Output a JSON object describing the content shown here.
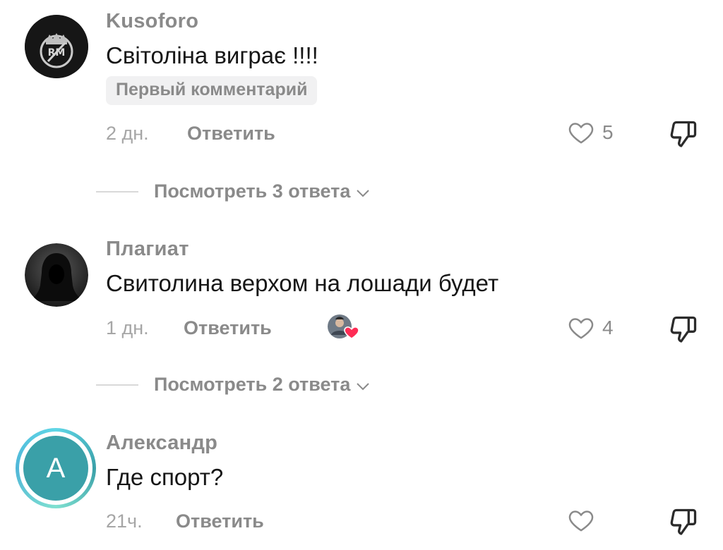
{
  "comments": [
    {
      "username": "Kusoforo",
      "text": "Світоліна виграє !!!!",
      "badge": "Первый комментарий",
      "time": "2 дн.",
      "reply_label": "Ответить",
      "likes": "5",
      "view_replies": "Посмотреть 3 ответа"
    },
    {
      "username": "Плагиат",
      "text": "Свитолина верхом на лошади будет",
      "time": "1 дн.",
      "reply_label": "Ответить",
      "likes": "4",
      "view_replies": "Посмотреть 2 ответа"
    },
    {
      "username": "Александр",
      "avatar_letter": "A",
      "text": "Где спорт?",
      "time": "21ч.",
      "reply_label": "Ответить",
      "likes": ""
    }
  ],
  "colors": {
    "text": "#161616",
    "muted": "#8a8a8a",
    "badge_bg": "#f1f1f2",
    "heart_red": "#fe2c55",
    "avatar_teal": "#3aa0a8"
  },
  "icons": {
    "like": "heart-outline-icon",
    "dislike": "thumbs-down-icon",
    "expand": "chevron-down-icon"
  }
}
